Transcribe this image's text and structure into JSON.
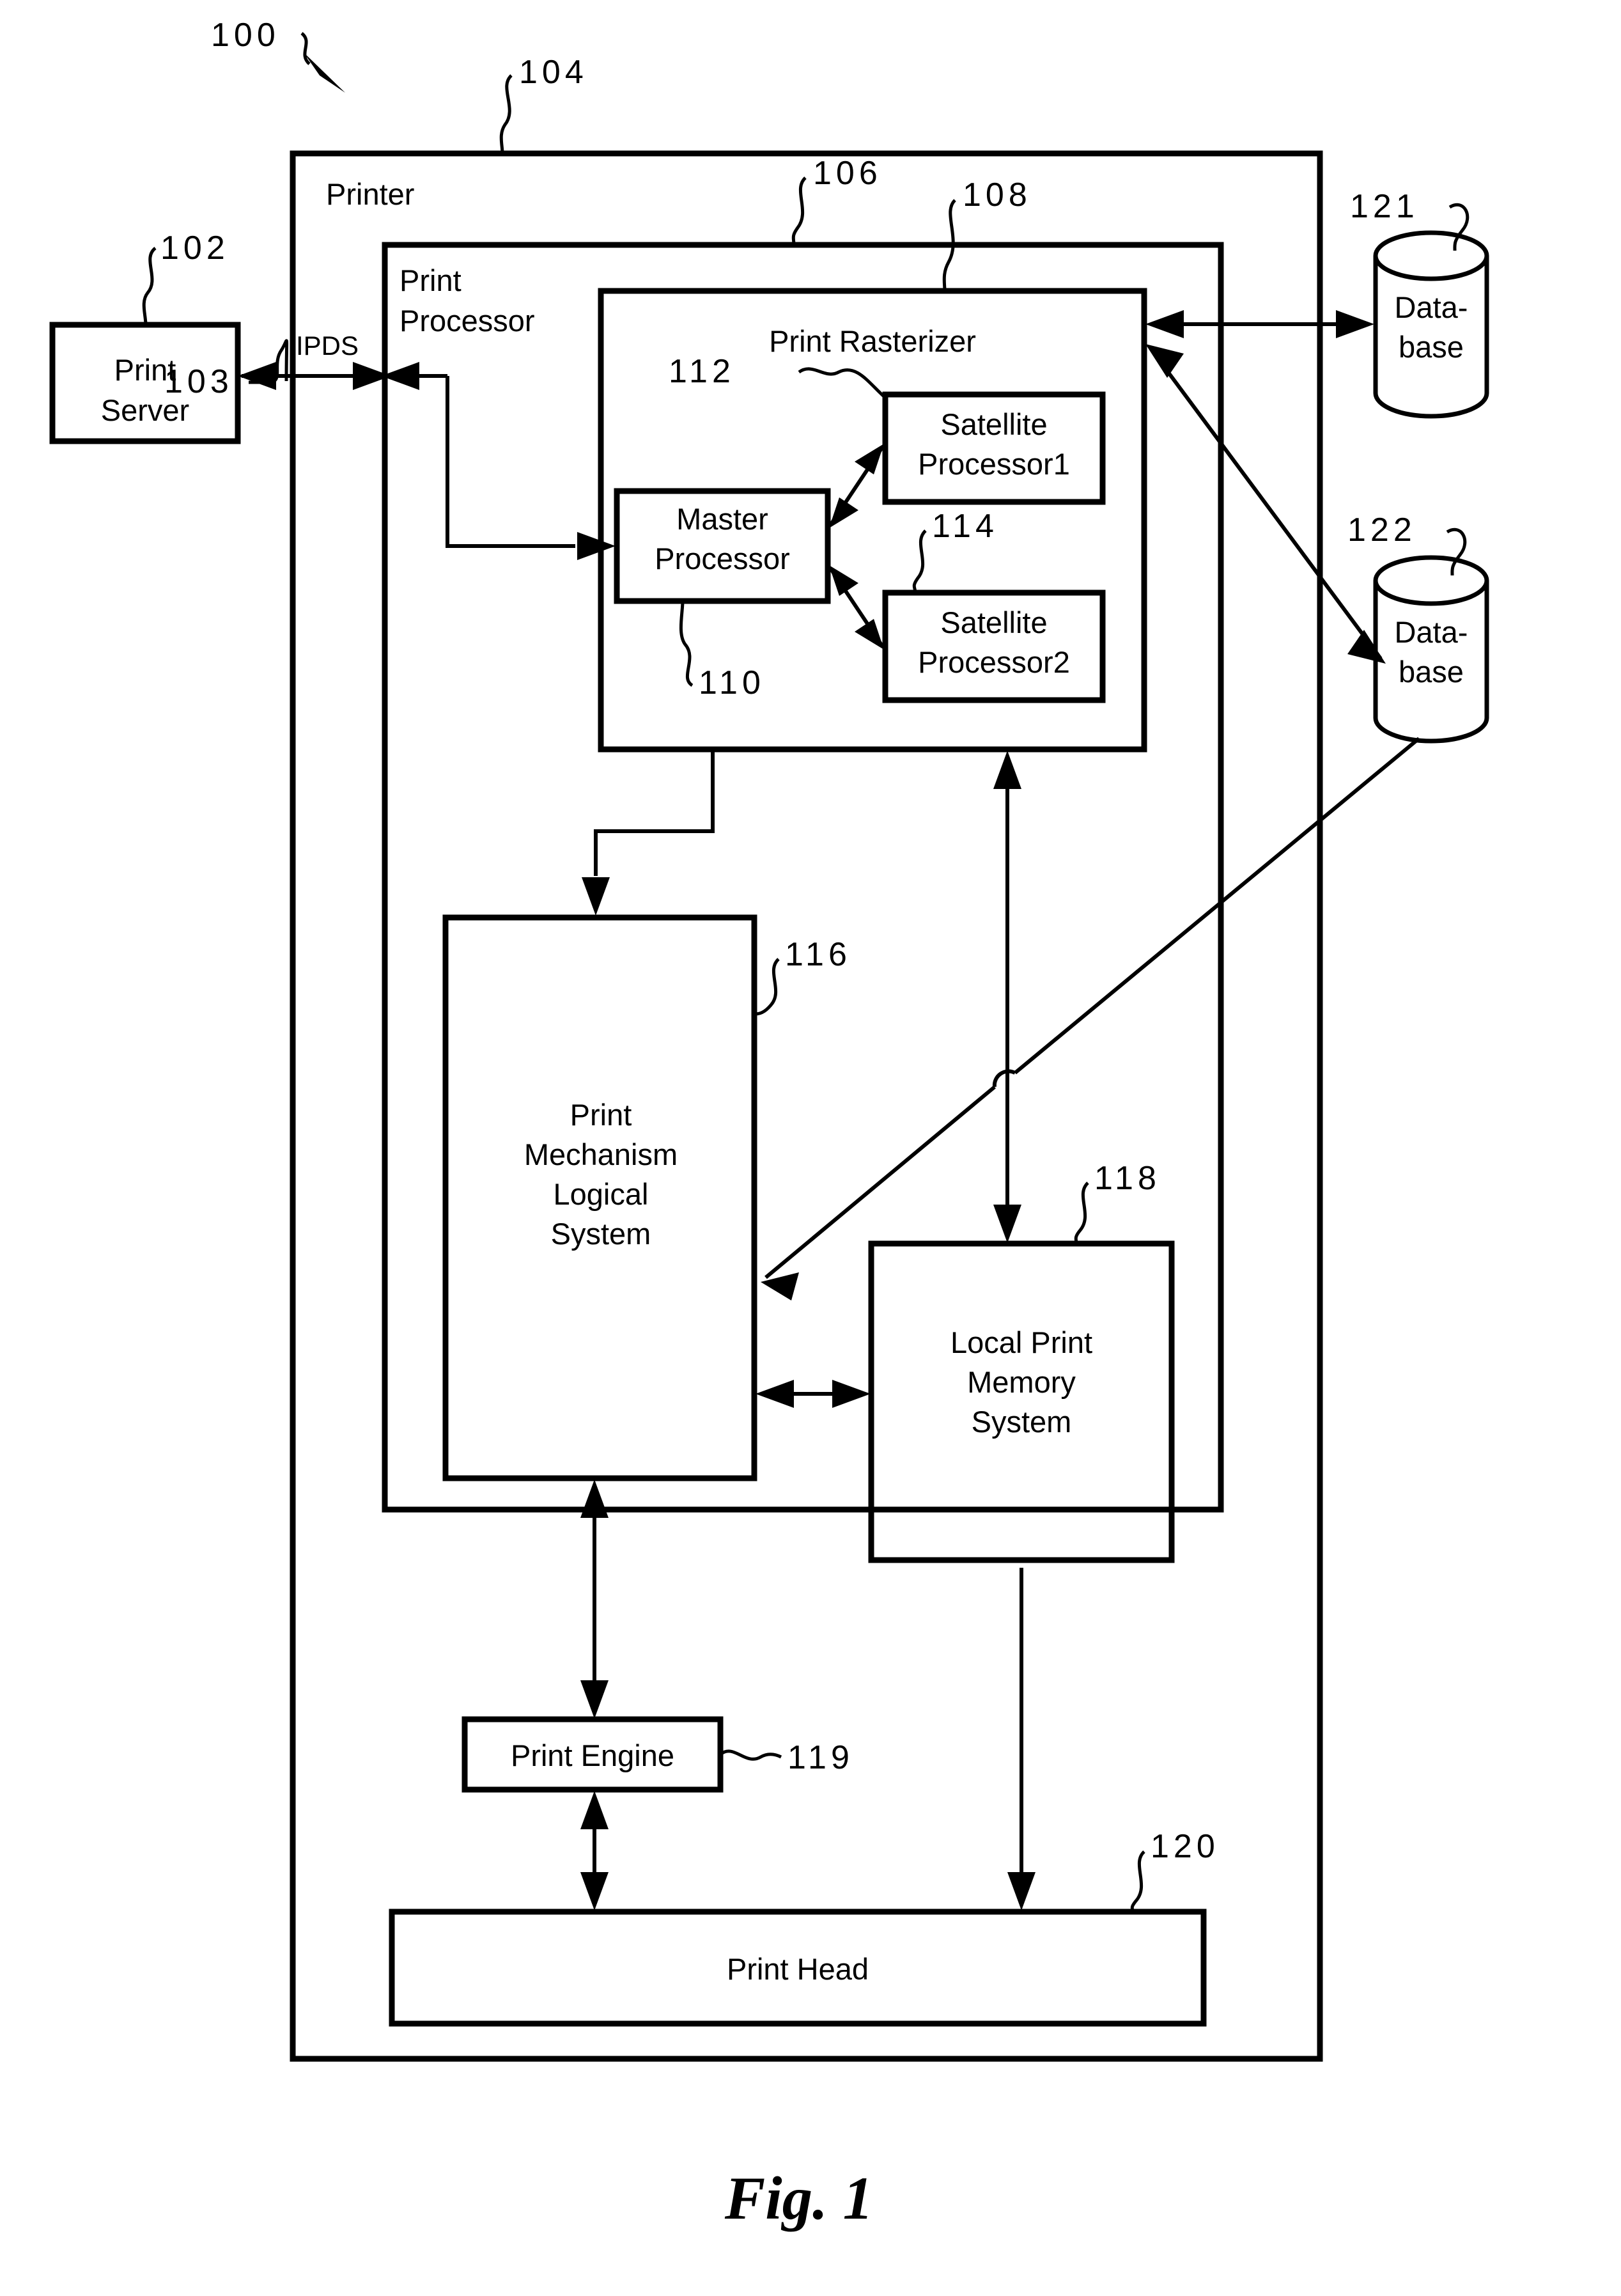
{
  "figure": {
    "caption": "Fig.  1",
    "system_ref": "100"
  },
  "blocks": {
    "print_server": {
      "label_line1": "Print",
      "label_line2": "Server",
      "ref": "102"
    },
    "printer": {
      "label": "Printer",
      "ref": "104"
    },
    "print_processor": {
      "label_line1": "Print",
      "label_line2": "Processor",
      "ref": "106"
    },
    "print_rasterizer": {
      "label": "Print Rasterizer",
      "ref": "108"
    },
    "master_processor": {
      "label_line1": "Master",
      "label_line2": "Processor",
      "ref": "110"
    },
    "satellite_processor_1": {
      "label_line1": "Satellite",
      "label_line2": "Processor1",
      "ref": "112"
    },
    "satellite_processor_2": {
      "label_line1": "Satellite",
      "label_line2": "Processor2",
      "ref": "114"
    },
    "print_mechanism_logical_system": {
      "label_line1": "Print",
      "label_line2": "Mechanism",
      "label_line3": "Logical",
      "label_line4": "System",
      "ref": "116"
    },
    "local_print_memory_system": {
      "label_line1": "Local Print",
      "label_line2": "Memory",
      "label_line3": "System",
      "ref": "118"
    },
    "print_engine": {
      "label": "Print Engine",
      "ref": "119"
    },
    "print_head": {
      "label": "Print Head",
      "ref": "120"
    },
    "database_1": {
      "label_line1": "Data-",
      "label_line2": "base",
      "ref": "121"
    },
    "database_2": {
      "label_line1": "Data-",
      "label_line2": "base",
      "ref": "122"
    }
  },
  "connections": {
    "ipds_label": "IPDS",
    "ipds_ref": "103"
  },
  "colors": {
    "ink": "#000000",
    "paper": "#ffffff"
  }
}
